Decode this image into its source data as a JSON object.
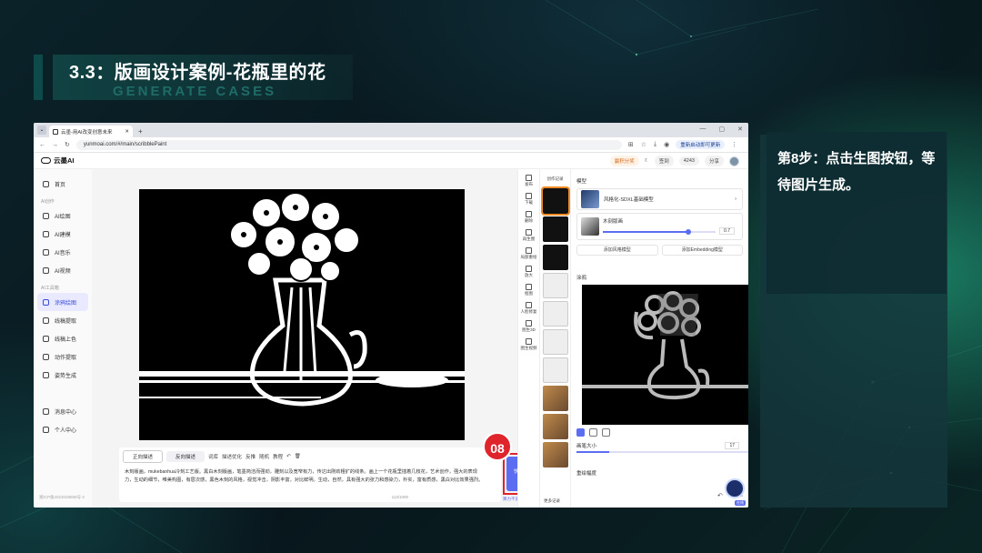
{
  "slide": {
    "title": "3.3：版画设计案例-花瓶里的花",
    "subtitle": "GENERATE CASES",
    "step_note": "第8步：点击生图按钮，等待图片生成。",
    "step_number": "08"
  },
  "browser": {
    "tab_title": "云墨-用AI改变创意未来",
    "url": "yunmoai.com/#/main/scribblePaint",
    "update_label": "重新启动即可更新"
  },
  "app": {
    "logo": "云墨AI",
    "header": {
      "signin": "签到",
      "points": "4243",
      "share": "分享",
      "vip": "赢积分奖"
    },
    "nav": {
      "home": "首页",
      "section_create": "AI创作",
      "items_create": [
        "AI绘图",
        "AI建模",
        "AI音乐",
        "AI视频"
      ],
      "section_tools": "AI工具箱",
      "items_tools": [
        "涂鸦绘图",
        "线稿提取",
        "线稿上色",
        "动作提取",
        "姿势生成"
      ],
      "messages": "消息中心",
      "profile": "个人中心",
      "footer": "湘ICP备2023028888号-2"
    },
    "prompt": {
      "tab_positive": "正向描述",
      "tab_negative": "反向描述",
      "tools": [
        "词库",
        "描述优化",
        "反推",
        "随机",
        "教程"
      ],
      "text": "木刻版画，mukebanhua冷刻工艺版。黑白木刻版画，笔墨简洁而强劲，雕刻以及宽窄有力，传达出刚劲粗犷的线条。画上一个花瓶里插着几枝花，艺术创作，强大的表现力，生动的细节，唯美构图，有层次感，黑色木刻的风格，视觉冲击，阴影丰富，对比鲜明。生动，自然，具有强大的张力和感染力，朴实，富有质感，黑白对比效果强烈。",
      "count": "113/1000",
      "generate_label": "快速生图",
      "generate_sub": "12算力",
      "generate_link": "算力不足?去充值>>"
    },
    "tools": [
      "发布",
      "下载",
      "删除",
      "再生图",
      "局部重绘",
      "放大",
      "抠图",
      "人脸修复",
      "图生3D",
      "图生视频"
    ],
    "history": {
      "title": "创作记录",
      "more": "更多记录"
    },
    "right": {
      "model_label": "模型",
      "model_name": "风格化-SDXL基础模型",
      "lora_name": "木刻版画",
      "lora_weight": "0.7",
      "add_style": "添加风格模型",
      "add_embedding": "添加Embedding模型",
      "sketch_label": "涂鸦",
      "brush_label": "画笔大小",
      "brush_value": "17",
      "strength_label": "重绘幅度",
      "assistant": "在线"
    }
  }
}
